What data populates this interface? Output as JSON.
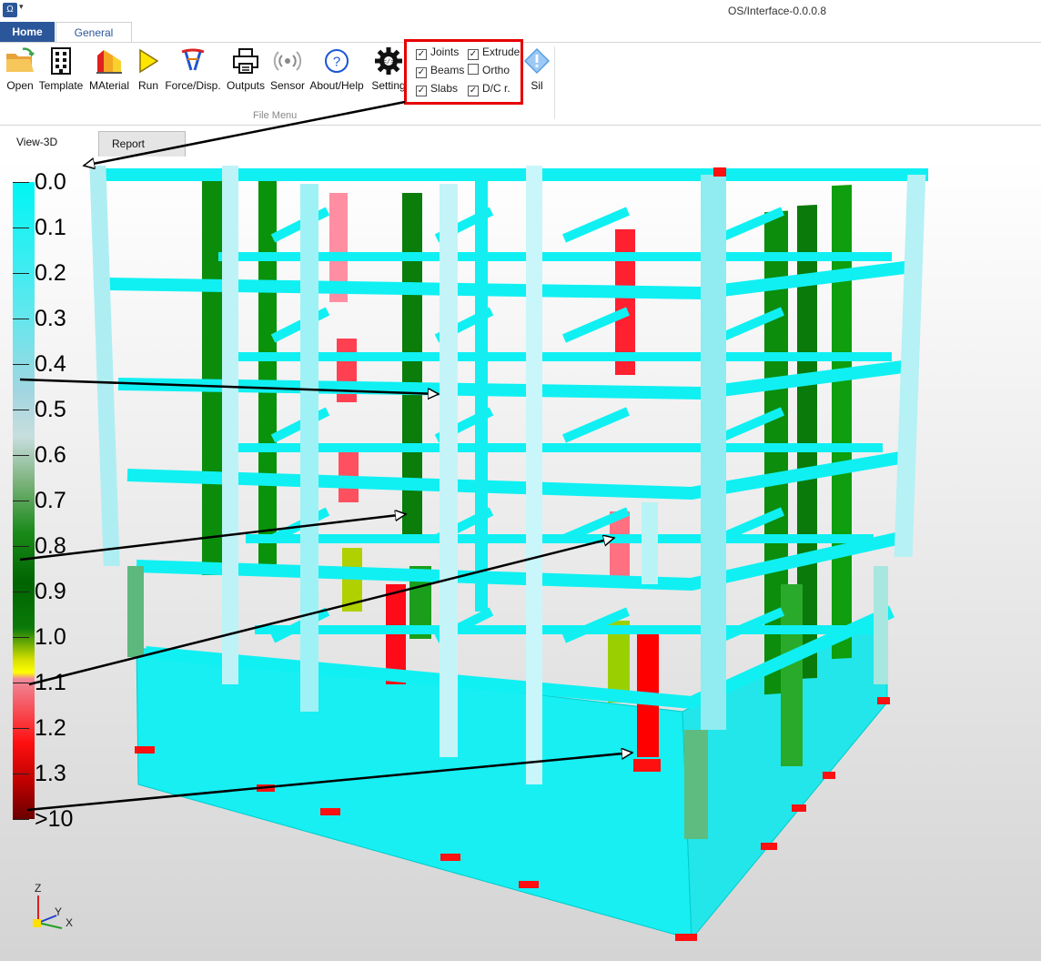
{
  "titlebar": {
    "app_icon": "app-icon",
    "title": "OS/Interface-0.0.0.8"
  },
  "ribbon_tabs": [
    {
      "label": "Home"
    },
    {
      "label": "General"
    }
  ],
  "ribbon": {
    "buttons": [
      {
        "label": "Open",
        "icon": "folder-open-icon"
      },
      {
        "label": "Template",
        "icon": "building-icon"
      },
      {
        "label": "MAterial",
        "icon": "material-icon"
      },
      {
        "label": "Run",
        "icon": "play-icon"
      },
      {
        "label": "Force/Disp.",
        "icon": "force-icon"
      },
      {
        "label": "Outputs",
        "icon": "printer-icon"
      },
      {
        "label": "Sensor",
        "icon": "sensor-icon"
      },
      {
        "label": "About/Help",
        "icon": "help-icon"
      },
      {
        "label": "Setting",
        "icon": "gear-icon"
      },
      {
        "label": "Sil",
        "icon": "warning-icon"
      }
    ],
    "group_label": "File Menu",
    "checkboxes": [
      {
        "label": "Joints",
        "checked": true
      },
      {
        "label": "Extrude",
        "checked": true
      },
      {
        "label": "Beams",
        "checked": true
      },
      {
        "label": "Ortho",
        "checked": false
      },
      {
        "label": "Slabs",
        "checked": true
      },
      {
        "label": "D/C r.",
        "checked": true
      }
    ]
  },
  "view_tabs": [
    {
      "label": "View-3D"
    },
    {
      "label": "Report"
    }
  ],
  "legend": {
    "labels": [
      "0.0",
      "0.1",
      "0.2",
      "0.3",
      "0.4",
      "0.5",
      "0.6",
      "0.7",
      "0.8",
      "0.9",
      "1.0",
      "1.1",
      "1.2",
      "1.3",
      ">10"
    ]
  },
  "axis_triad": {
    "z": "Z",
    "y": "Y",
    "x": "X"
  },
  "colors": {
    "accent": "#2b579a",
    "highlight_border": "#e60000",
    "member_cyan": "#00f5f5",
    "member_green": "#0a8a0a",
    "member_red": "#ff2020",
    "support_red": "#ff0000"
  }
}
